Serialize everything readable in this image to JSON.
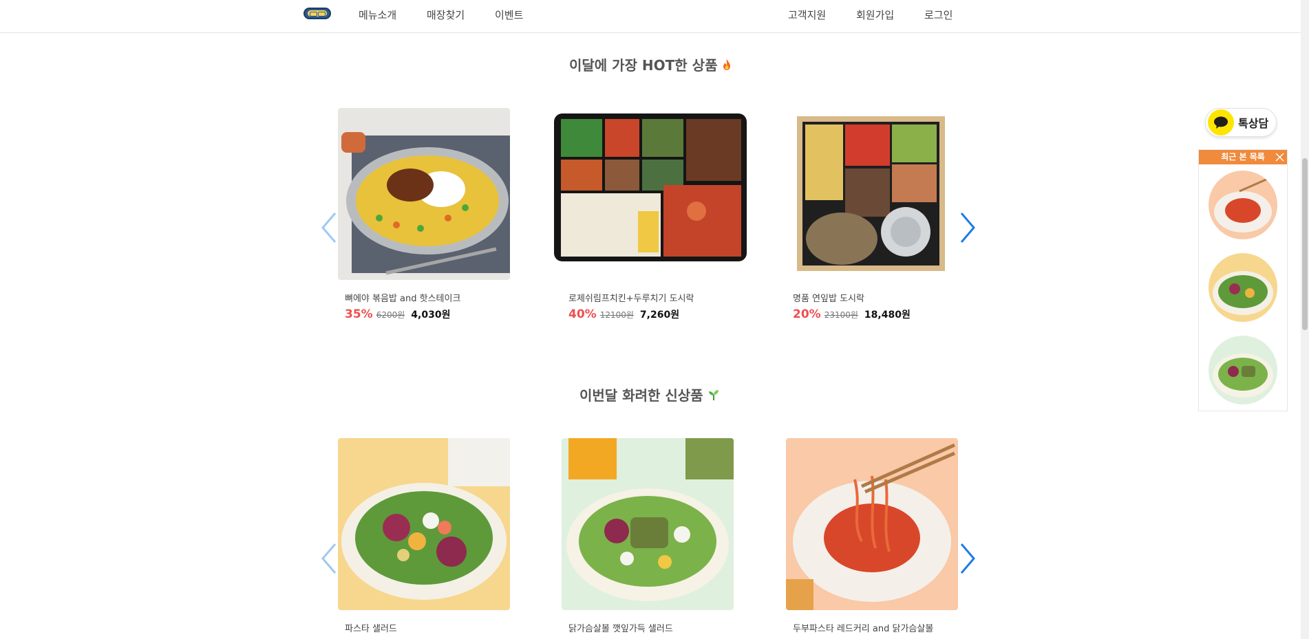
{
  "header": {
    "nav_left": [
      "메뉴소개",
      "매장찾기",
      "이벤트"
    ],
    "nav_right": [
      "고객지원",
      "회원가입",
      "로그인"
    ]
  },
  "hot_section": {
    "title": "이달에 가장 HOT한 상품",
    "icon": "fire-icon",
    "products": [
      {
        "name": "뼈에야 볶음밥 and 핫스테이크",
        "discount": "35%",
        "original": "6200원",
        "price": "4,030원"
      },
      {
        "name": "로제쉬림프치킨+두루치기 도시락",
        "discount": "40%",
        "original": "12100원",
        "price": "7,260원"
      },
      {
        "name": "명품 연잎밥 도시락",
        "discount": "20%",
        "original": "23100원",
        "price": "18,480원"
      }
    ]
  },
  "new_section": {
    "title": "이번달 화려한 신상품",
    "icon": "sprout-icon",
    "products": [
      {
        "name": "파스타 샐러드"
      },
      {
        "name": "닭가슴살볼 깻잎가득 샐러드"
      },
      {
        "name": "두부파스타 레드커리 and 닭가슴살볼"
      }
    ]
  },
  "widgets": {
    "kakao_label": "톡상담",
    "recent_title": "최근 본 목록"
  },
  "colors": {
    "accent_orange": "#f08a3c",
    "discount_red": "#f04e4e",
    "arrow_blue": "#1d7be5",
    "kakao_yellow": "#fee500"
  }
}
